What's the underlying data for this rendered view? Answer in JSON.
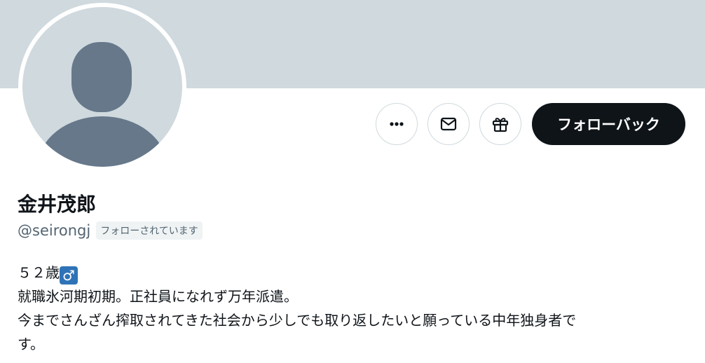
{
  "profile": {
    "display_name": "金井茂郎",
    "handle": "@seirongj",
    "follows_you_label": "フォローされています",
    "follow_back_label": "フォローバック",
    "bio": {
      "line1_text": "５２歳",
      "line1_emoji": "♂",
      "line2": "就職氷河期初期。正社員になれず万年派遣。",
      "line3": "今までさんざん搾取されてきた社会から少しでも取り返したいと願っている中年独身者で",
      "line4": "す。"
    }
  },
  "icons": {
    "more": "more-horizontal-icon",
    "mail": "mail-icon",
    "gift": "gift-icon",
    "avatar": "default-avatar-silhouette"
  },
  "colors": {
    "banner": "#cfd9de",
    "avatar_bg": "#cfd9de",
    "avatar_silhouette": "#66788a",
    "primary_button": "#0f1419",
    "secondary_text": "#536471",
    "badge_bg": "#eff3f4",
    "emoji_bg": "#2f73b7"
  }
}
